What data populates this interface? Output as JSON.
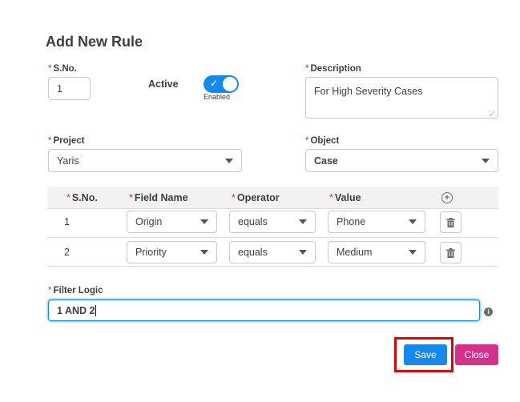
{
  "dialog": {
    "title": "Add New Rule"
  },
  "form": {
    "sno_label": "S.No.",
    "sno_value": "1",
    "active_label": "Active",
    "active_state": "Enabled",
    "description_label": "Description",
    "description_value": "For High Severity Cases",
    "project_label": "Project",
    "project_value": "Yaris",
    "object_label": "Object",
    "object_value": "Case",
    "required_marker": "*"
  },
  "criteria": {
    "headers": {
      "sno": "S.No.",
      "field": "Field Name",
      "operator": "Operator",
      "value": "Value"
    },
    "rows": [
      {
        "sno": "1",
        "field": "Origin",
        "operator": "equals",
        "value": "Phone"
      },
      {
        "sno": "2",
        "field": "Priority",
        "operator": "equals",
        "value": "Medium"
      }
    ]
  },
  "filter_logic": {
    "label": "Filter Logic",
    "value": "1 AND 2"
  },
  "buttons": {
    "save": "Save",
    "close": "Close"
  },
  "colors": {
    "primary": "#1589ee",
    "close": "#d6308d",
    "required": "#c23934",
    "highlight": "#e00000"
  }
}
